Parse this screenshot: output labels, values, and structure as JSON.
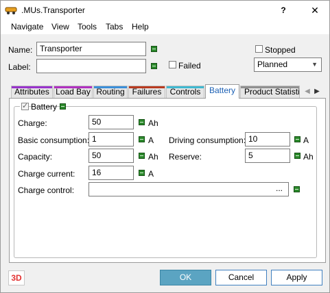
{
  "window": {
    "title": ".MUs.Transporter",
    "help": "?",
    "close": "✕"
  },
  "menu": [
    "Navigate",
    "View",
    "Tools",
    "Tabs",
    "Help"
  ],
  "header": {
    "name_label": "Name:",
    "name_value": "Transporter",
    "label_label": "Label:",
    "label_value": "",
    "failed_label": "Failed",
    "failed_checked": false,
    "stopped_label": "Stopped",
    "stopped_checked": false,
    "state_value": "Planned"
  },
  "tabs": [
    {
      "label": "Attributes",
      "color": "#9933cc",
      "active": false
    },
    {
      "label": "Load Bay",
      "color": "#b030c0",
      "active": false
    },
    {
      "label": "Routing",
      "color": "#3b8fd9",
      "active": false
    },
    {
      "label": "Failures",
      "color": "#b83a20",
      "active": false
    },
    {
      "label": "Controls",
      "color": "#3fb8d0",
      "active": false
    },
    {
      "label": "Battery",
      "color": "#ffffff",
      "active": true
    },
    {
      "label": "Product Statistics",
      "color": "#909090",
      "active": false
    }
  ],
  "battery": {
    "group_label": "Battery",
    "enabled": true,
    "charge": {
      "label": "Charge:",
      "value": "50",
      "unit": "Ah"
    },
    "basic_consumption": {
      "label": "Basic consumption:",
      "value": "1",
      "unit": "A"
    },
    "driving_consumption": {
      "label": "Driving consumption:",
      "value": "10",
      "unit": "A"
    },
    "capacity": {
      "label": "Capacity:",
      "value": "50",
      "unit": "Ah"
    },
    "reserve": {
      "label": "Reserve:",
      "value": "5",
      "unit": "Ah"
    },
    "charge_current": {
      "label": "Charge current:",
      "value": "16",
      "unit": "A"
    },
    "charge_control": {
      "label": "Charge control:",
      "value": "",
      "browse": "..."
    }
  },
  "footer": {
    "threed": "3D",
    "ok": "OK",
    "cancel": "Cancel",
    "apply": "Apply"
  }
}
